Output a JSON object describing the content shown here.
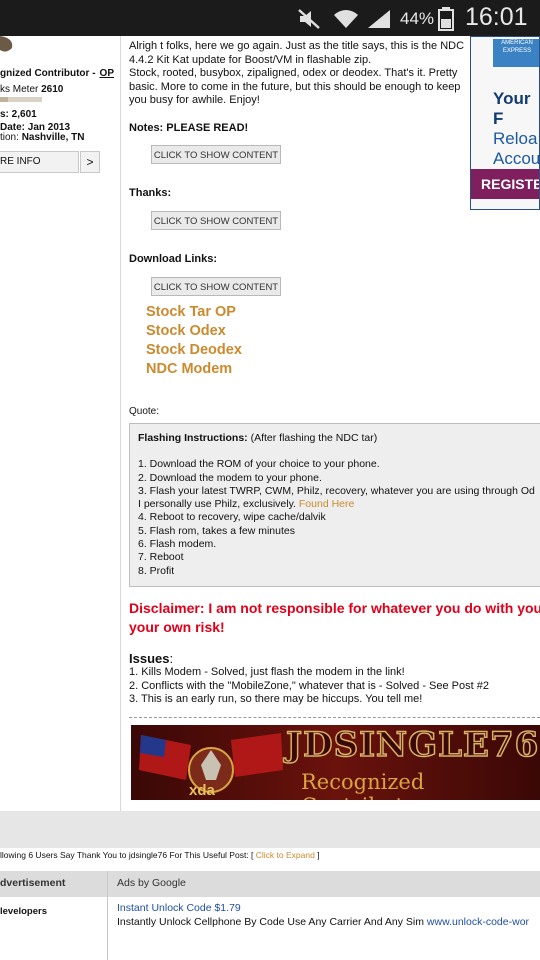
{
  "status_bar": {
    "battery_percent": "44%",
    "time": "16:01"
  },
  "sidebar": {
    "user_title": "gnized Contributor -",
    "op_badge": "OP",
    "thanks_meter_label": "ks Meter",
    "thanks_meter_value": "2610",
    "thanks_meter_level": 0.2,
    "posts": "s: 2,601",
    "join_date": "Date: Jan 2013",
    "location_label": "tion:",
    "location_value": "Nashville, TN",
    "more_info_label": "RE INFO",
    "expand_label": ">"
  },
  "post": {
    "intro": "Alrigh t folks, here we go again. Just as the title says, this is the NDC 4.4.2 Kit Kat update for Boost/VM in flashable zip.",
    "intro2": "Stock, rooted, busybox, zipaligned, odex or deodex. That's it. Pretty basic. More to come in the future, but this should be enough to keep you busy for awhile. Enjoy!",
    "notes_label": "Notes: PLEASE READ!",
    "thanks_label": "Thanks:",
    "download_label": "Download Links:",
    "spoiler_button_label": "CLICK TO SHOW CONTENT",
    "download_links": [
      "Stock Tar OP",
      "Stock Odex",
      "Stock Deodex",
      "NDC Modem"
    ],
    "quote_label": "Quote:"
  },
  "ad_banner": {
    "brand": "AMERICAN EXPRESS",
    "text_line1": "Your F",
    "text_line2": "Reloa",
    "text_line3": "Accou",
    "cta": "REGISTE"
  },
  "quote": {
    "title_bold": "Flashing Instructions:",
    "title_rest": " (After flashing the NDC tar)",
    "steps": [
      "1. Download the ROM of your choice to your phone.",
      "2. Download the modem to your phone.",
      "3. Flash your latest TWRP, CWM, Philz, recovery, whatever you are using through Od",
      "I personally use Philz, exclusively.",
      "4. Reboot to recovery, wipe cache/dalvik",
      "5. Flash rom, takes a few minutes",
      "6. Flash modem.",
      "7. Reboot",
      "8. Profit"
    ],
    "found_here_link": "Found Here"
  },
  "disclaimer": {
    "line1": "Disclaimer: I am not responsible for whatever you do with you",
    "line2": "your own risk!"
  },
  "issues": {
    "heading": "Issues",
    "heading_suffix": ":",
    "items": [
      "1. Kills Modem - Solved, just flash the modem in the link!",
      "2. Conflicts with the \"MobileZone,\" whatever that is - Solved - See Post #2",
      "3. This is an early run, so there may be hiccups. You tell me!"
    ]
  },
  "signature": {
    "name": "JDSINGLE76",
    "subtitle": "Recognized Contributor",
    "logo_text": "xda"
  },
  "thanks_footer": {
    "text": "llowing 6 Users Say Thank You to jdsingle76 For This Useful Post: [ ",
    "expand_link": "Click to Expand",
    "close": " ]"
  },
  "ads_section": {
    "left_header": "dvertisement",
    "right_header": "Ads by Google",
    "left_row": "levelopers",
    "ad_title": "Instant Unlock Code $1.79",
    "ad_desc": "Instantly Unlock Cellphone By Code Use Any Carrier And Any Sim ",
    "ad_url": "www.unlock-code-wor"
  }
}
